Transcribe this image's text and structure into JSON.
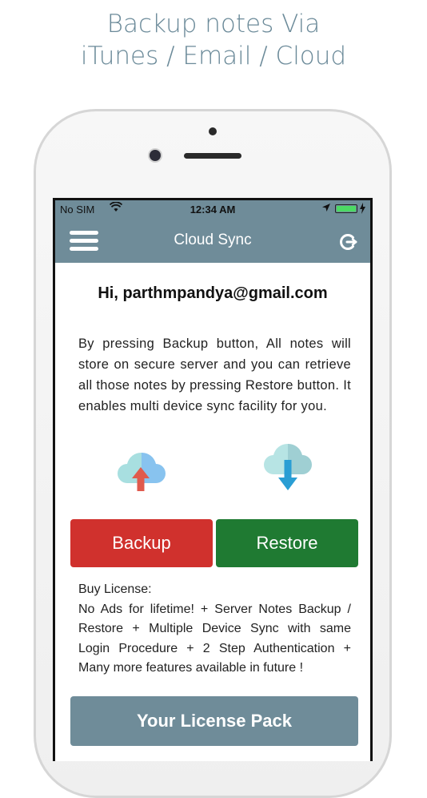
{
  "promo": {
    "line1": "Backup notes Via",
    "line2": "iTunes / Email / Cloud"
  },
  "status_bar": {
    "carrier": "No SIM",
    "time": "12:34 AM"
  },
  "nav": {
    "title": "Cloud Sync",
    "menu_icon": "hamburger-menu-icon",
    "logout_icon": "logout-icon"
  },
  "greeting": "Hi, parthmpandya@gmail.com",
  "description": "By pressing Backup button, All notes will store on secure server and you can retrieve all those notes by pressing Restore button. It enables multi device sync facility for you.",
  "buttons": {
    "backup": "Backup",
    "restore": "Restore",
    "license_pack": "Your License Pack"
  },
  "license": {
    "title": "Buy License:",
    "body": "No Ads for lifetime! + Server Notes Backup / Restore + Multiple Device Sync with same Login Procedure + 2 Step Authentication + Many more features available in future !"
  },
  "colors": {
    "header": "#6f8c99",
    "backup": "#d0312d",
    "restore": "#1f7a32",
    "license_pack": "#6f8c99"
  }
}
